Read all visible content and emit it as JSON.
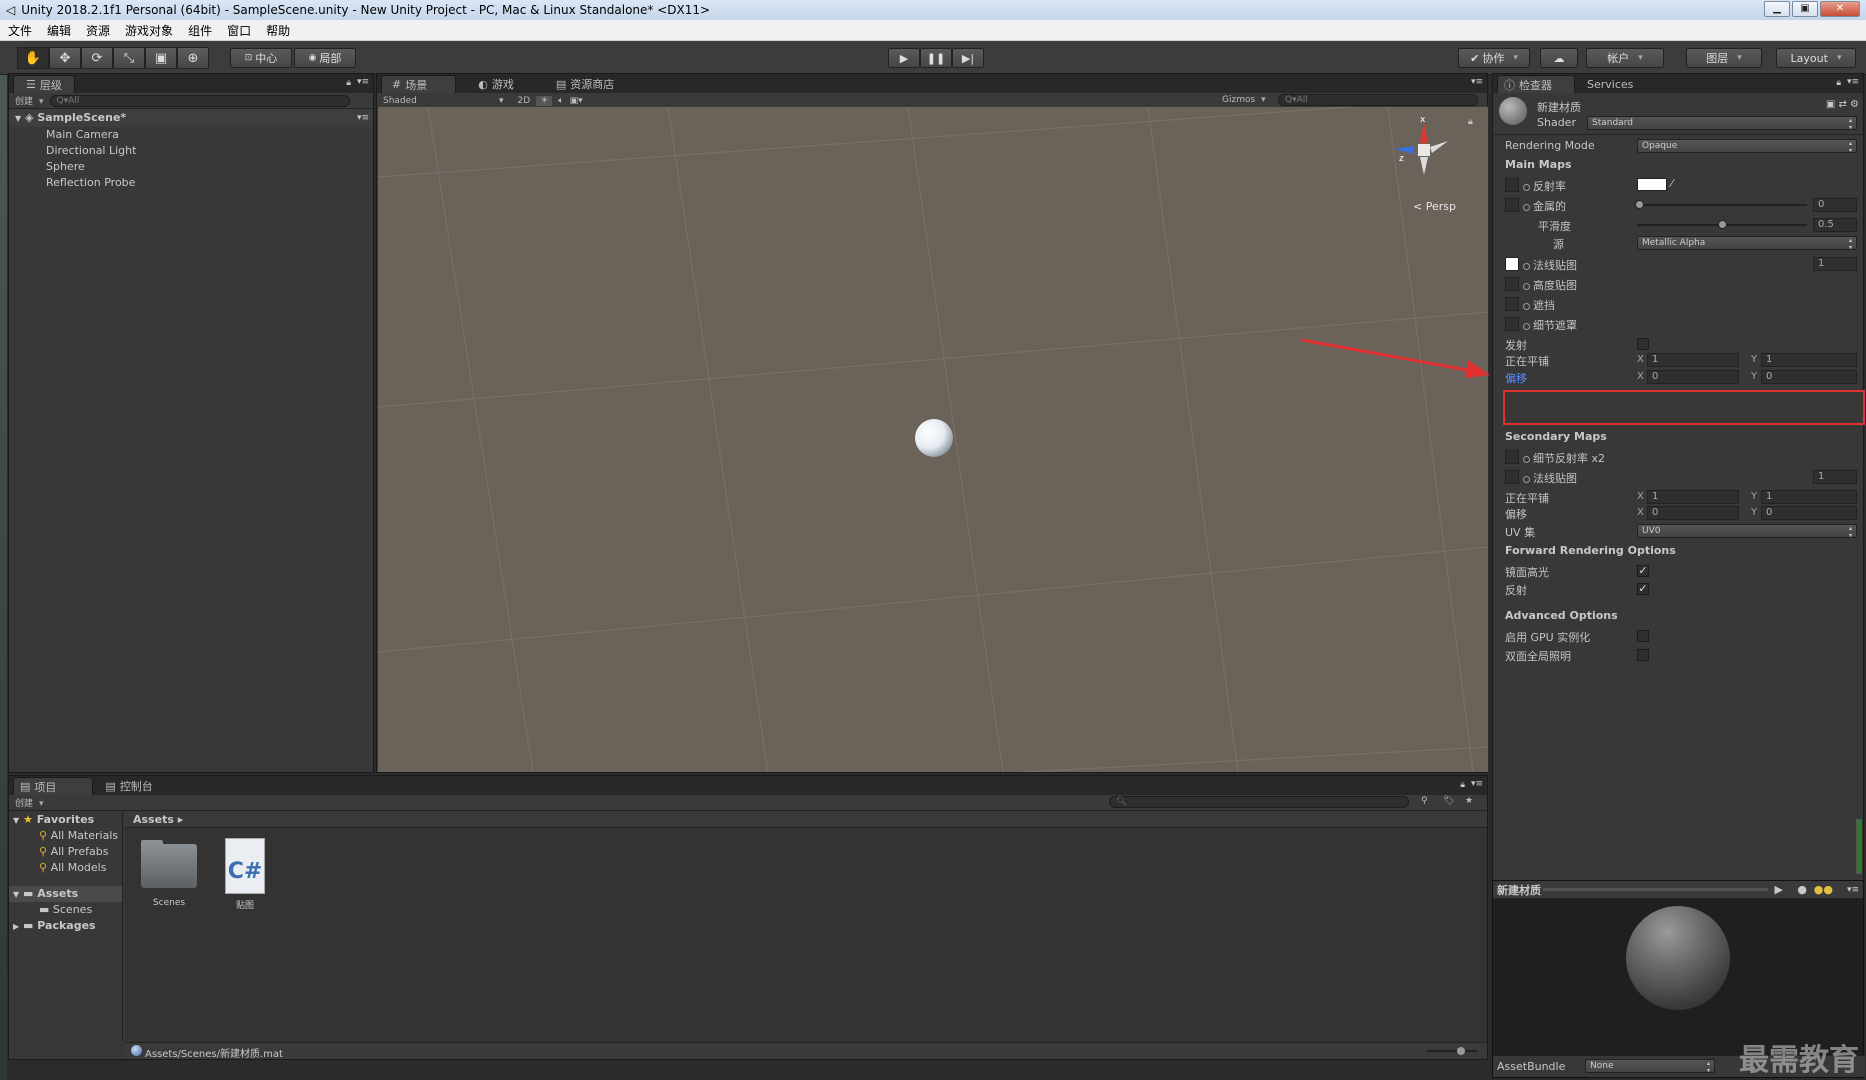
{
  "window": {
    "title": "Unity 2018.2.1f1 Personal (64bit) - SampleScene.unity - New Unity Project - PC, Mac & Linux Standalone* <DX11>"
  },
  "menu": [
    "文件",
    "编辑",
    "资源",
    "游戏对象",
    "组件",
    "窗口",
    "帮助"
  ],
  "toolbar": {
    "pivot": "中心",
    "space": "局部",
    "collab": "协作",
    "account": "帐户",
    "layers": "图层",
    "layout": "Layout"
  },
  "hierarchy": {
    "tab": "层级",
    "create": "创建",
    "search_placeholder": "Q▾All",
    "scene": "SampleScene*",
    "items": [
      "Main Camera",
      "Directional Light",
      "Sphere",
      "Reflection Probe"
    ]
  },
  "scene_view": {
    "tabs": [
      "场景",
      "游戏",
      "资源商店"
    ],
    "shading": "Shaded",
    "mode_2d": "2D",
    "gizmos": "Gizmos",
    "search_placeholder": "Q▾All",
    "persp": "Persp",
    "axis_x": "x",
    "axis_z": "z"
  },
  "inspector": {
    "tabs": [
      "检查器",
      "Services"
    ],
    "material_name": "新建材质",
    "shader_label": "Shader",
    "shader_value": "Standard",
    "rendering_mode_label": "Rendering Mode",
    "rendering_mode_value": "Opaque",
    "main_maps": "Main Maps",
    "albedo": "反射率",
    "metallic": "金属的",
    "metallic_value": "0",
    "smoothness": "平滑度",
    "smoothness_value": "0.5",
    "source": "源",
    "source_value": "Metallic Alpha",
    "normal_map": "法线贴图",
    "normal_value": "1",
    "height_map": "高度贴图",
    "occlusion": "遮挡",
    "detail_mask": "细节遮罩",
    "emission": "发射",
    "tiling": "正在平铺",
    "tiling_x": "1",
    "tiling_y": "1",
    "offset": "偏移",
    "offset_x": "0",
    "offset_y": "0",
    "secondary_maps": "Secondary Maps",
    "detail_albedo": "细节反射率 x2",
    "sec_normal": "法线贴图",
    "sec_normal_value": "1",
    "sec_tiling": "正在平铺",
    "sec_tiling_x": "1",
    "sec_tiling_y": "1",
    "sec_offset": "偏移",
    "sec_offset_x": "0",
    "sec_offset_y": "0",
    "uv_set": "UV 集",
    "uv_value": "UV0",
    "forward_options": "Forward Rendering Options",
    "specular": "镜面高光",
    "reflections": "反射",
    "advanced": "Advanced Options",
    "gpu_instancing": "启用 GPU 实例化",
    "double_sided_gi": "双面全局照明",
    "x": "X",
    "y": "Y",
    "highlight_color": "#e03030"
  },
  "preview": {
    "title": "新建材质",
    "assetbundle_label": "AssetBundle",
    "assetbundle_value": "None"
  },
  "project": {
    "tabs": [
      "项目",
      "控制台"
    ],
    "create": "创建",
    "favorites": "Favorites",
    "fav_items": [
      "All Materials",
      "All Prefabs",
      "All Models"
    ],
    "assets": "Assets",
    "asset_children": [
      "Scenes"
    ],
    "packages": "Packages",
    "breadcrumb": "Assets",
    "files": [
      {
        "name": "Scenes",
        "icon": "folder-icon"
      },
      {
        "name": "贴图",
        "icon": "csharp-script-icon",
        "glyph": "C#"
      }
    ],
    "status_path": "Assets/Scenes/新建材质.mat"
  },
  "watermark": "最需教育"
}
